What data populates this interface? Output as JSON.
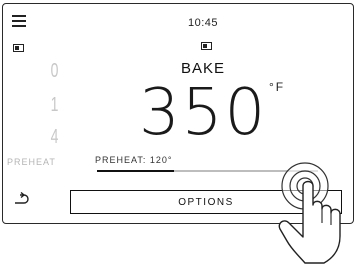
{
  "status": {
    "time": "10:45"
  },
  "cook": {
    "mode": "BAKE",
    "temperature": "350",
    "unit": "°F"
  },
  "preheat": {
    "label": "PREHEAT: 120°",
    "ghost_label": "PREHEAT",
    "progress": 0.35
  },
  "background_digits": [
    "0",
    "1",
    "4"
  ],
  "actions": {
    "options_label": "OPTIONS"
  },
  "icons": {
    "menu": "menu-icon",
    "small_panel": "panel-indicator-icon",
    "back": "back-arrow-icon",
    "hand": "hand-pointer-icon",
    "touch_ripple": "touch-ripple-icon"
  },
  "colors": {
    "ink": "#1a1a1a",
    "track": "#bdbdbd",
    "ghost": "#c8c8c8"
  }
}
